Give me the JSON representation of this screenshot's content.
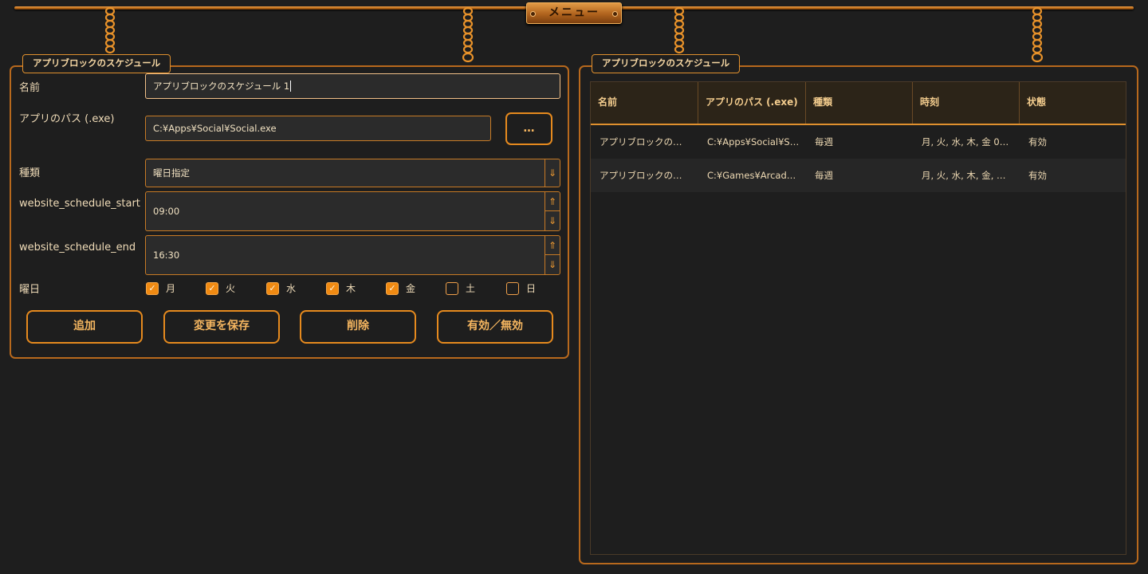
{
  "menu": {
    "label": "メニュー"
  },
  "left_panel": {
    "title": "アプリブロックのスケジュール",
    "name_label": "名前",
    "name_value": "アプリブロックのスケジュール 1",
    "path_label": "アプリのパス (.exe)",
    "path_value": "C:¥Apps¥Social¥Social.exe",
    "browse_label": "…",
    "type_label": "種類",
    "type_value": "曜日指定",
    "start_label": "website_schedule_start",
    "start_value": "09:00",
    "end_label": "website_schedule_end",
    "end_value": "16:30",
    "days_label": "曜日",
    "days": [
      {
        "label": "月",
        "checked": true
      },
      {
        "label": "火",
        "checked": true
      },
      {
        "label": "水",
        "checked": true
      },
      {
        "label": "木",
        "checked": true
      },
      {
        "label": "金",
        "checked": true
      },
      {
        "label": "土",
        "checked": false
      },
      {
        "label": "日",
        "checked": false
      }
    ],
    "buttons": {
      "add": "追加",
      "save": "変更を保存",
      "delete": "削除",
      "toggle": "有効／無効"
    }
  },
  "right_panel": {
    "title": "アプリブロックのスケジュール",
    "columns": [
      "名前",
      "アプリのパス (.exe)",
      "種類",
      "時刻",
      "状態"
    ],
    "rows": [
      [
        "アプリブロックの…",
        "C:¥Apps¥Social¥S…",
        "毎週",
        "月, 火, 水, 木, 金  0…",
        "有効"
      ],
      [
        "アプリブロックの…",
        "C:¥Games¥Arcad…",
        "毎週",
        "月, 火, 水, 木, 金, …",
        "有効"
      ]
    ]
  },
  "colors": {
    "accent": "#e68a1e",
    "background": "#1e1e1e",
    "text": "#ead7b0"
  }
}
